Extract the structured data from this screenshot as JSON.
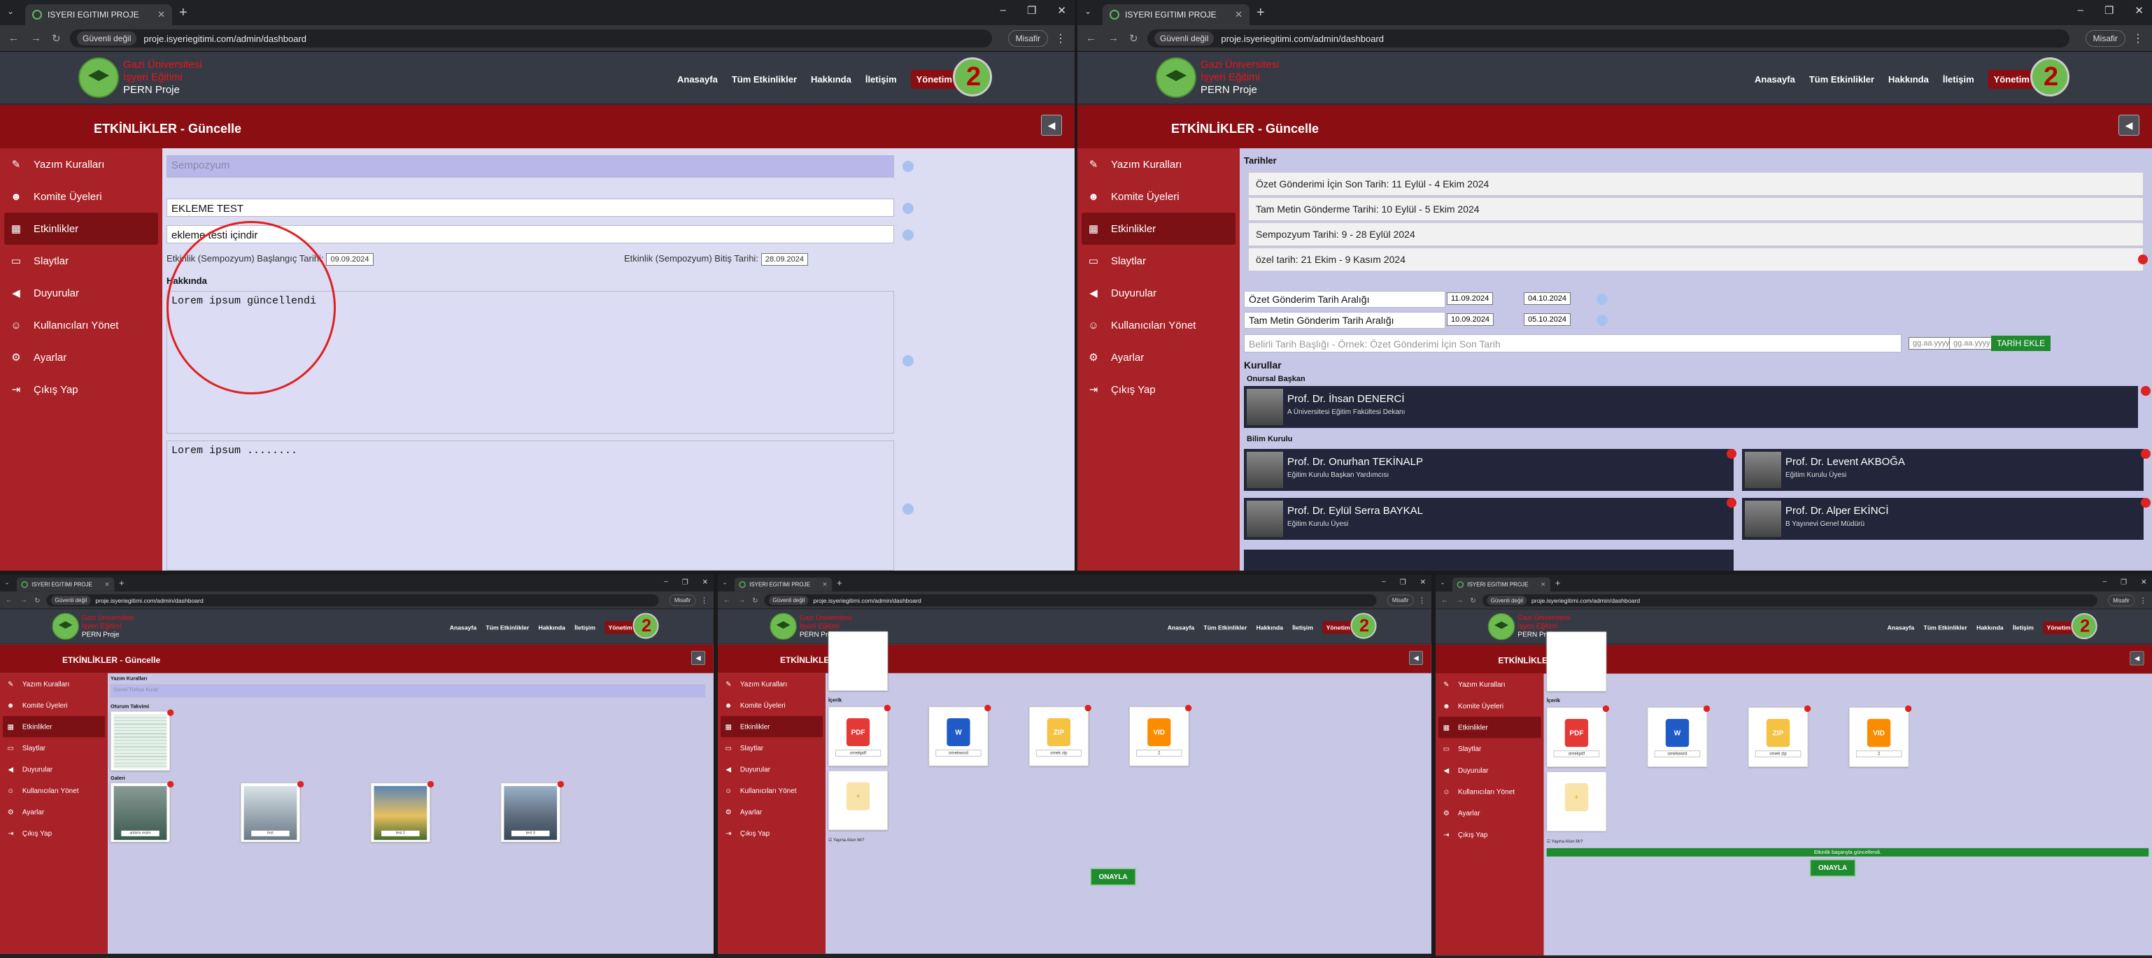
{
  "browser": {
    "tab_title": "ISYERI EGITIMI PROJE",
    "security_badge": "Güvenli değil",
    "url": "proje.isyeriegitimi.com/admin/dashboard",
    "guest_label": "Misafir"
  },
  "site": {
    "brand_line1": "Gazi Üniversitesi",
    "brand_line2": "İşyeri Eğitimi",
    "brand_line3": "PERN Proje",
    "nav": [
      "Anasayfa",
      "Tüm Etkinlikler",
      "Hakkında",
      "İletişim",
      "Yönetim"
    ]
  },
  "panel": {
    "title": "ETKİNLİKLER - Güncelle",
    "sidebar": [
      "Yazım Kuralları",
      "Komite Üyeleri",
      "Etkinlikler",
      "Slaytlar",
      "Duyurular",
      "Kullanıcıları Yönet",
      "Ayarlar",
      "Çıkış Yap"
    ]
  },
  "screen1": {
    "type_select": "Sempozyum",
    "event_title": "EKLEME TEST",
    "event_desc": "ekleme testi içindir",
    "start_label": "Etkinlik (Sempozyum) Başlangıç Tarihi:",
    "start_date": "09.09.2024",
    "end_label": "Etkinlik (Sempozyum) Bitiş Tarihi:",
    "end_date": "28.09.2024",
    "about_label": "Hakkında",
    "about_text": "Lorem ipsum güncellendi",
    "content_text": "Lorem ipsum ........"
  },
  "screen2": {
    "dates_label": "Tarihler",
    "date_rows": [
      "Özet Gönderimi İçin Son Tarih: 11 Eylül - 4 Ekim 2024",
      "Tam Metin Gönderme Tarihi: 10 Eylül - 5 Ekim 2024",
      "Sempozyum Tarihi: 9 - 28 Eylül 2024",
      "özel tarih: 21 Ekim - 9 Kasım 2024"
    ],
    "range1_label": "Özet Gönderim Tarih Aralığı",
    "range1_start": "11.09.2024",
    "range1_end": "04.10.2024",
    "range2_label": "Tam Metin Gönderim Tarih Aralığı",
    "range2_start": "10.09.2024",
    "range2_end": "05.10.2024",
    "custom_placeholder": "Belirli Tarih Başlığı - Örnek: Özet Gönderimi İçin Son Tarih",
    "date_placeholder": "gg.aa.yyyy",
    "add_date_button": "TARİH EKLE",
    "boards_label": "Kurullar",
    "honorary_label": "Onursal Başkan",
    "honorary": {
      "name": "Prof. Dr. İhsan DENERCİ",
      "role": "A Üniversitesi Eğitim Fakültesi Dekanı"
    },
    "science_label": "Bilim Kurulu",
    "science": [
      {
        "name": "Prof. Dr. Onurhan TEKİNALP",
        "role": "Eğitim Kurulu Başkan Yardımcısı"
      },
      {
        "name": "Prof. Dr. Levent AKBOĞA",
        "role": "Eğitim Kurulu Üyesi"
      },
      {
        "name": "Prof. Dr. Eylül Serra BAYKAL",
        "role": "Eğitim Kurulu Üyesi"
      },
      {
        "name": "Prof. Dr. Alper EKİNCİ",
        "role": "B Yayınevi Genel Müdürü"
      }
    ]
  },
  "screen3": {
    "rules_label": "Yazım Kuralları",
    "rules_select": "Genel Türkçe Kural",
    "schedule_label": "Oturum Takvimi",
    "gallery_label": "Galeri",
    "gallery": [
      "anlamı resim",
      "test",
      "test 2",
      "test 3"
    ]
  },
  "screen4": {
    "content_label": "İçerik",
    "files": [
      {
        "name": "ornekpdf",
        "kind": "PDF"
      },
      {
        "name": "ornekword",
        "kind": "W"
      },
      {
        "name": "ornek zip",
        "kind": "ZIP"
      },
      {
        "name": "2",
        "kind": "VID"
      }
    ],
    "publish_label": "Yayına Alsın Mı?",
    "approve_button": "ONAYLA"
  },
  "screen5": {
    "success_message": "Etkinlik başarıyla güncellendi."
  }
}
